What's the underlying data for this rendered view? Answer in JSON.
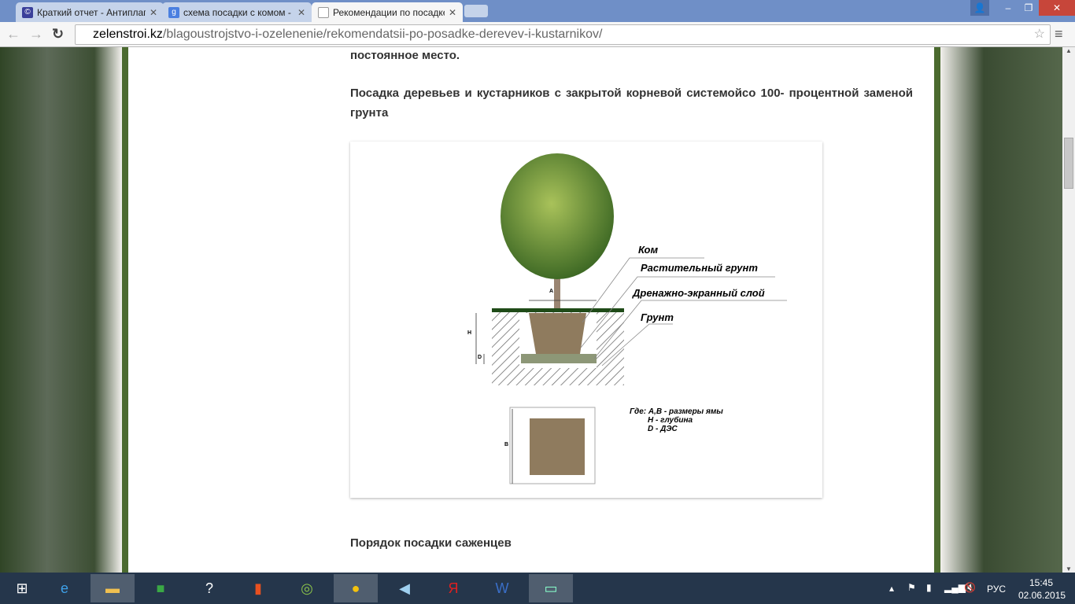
{
  "browser": {
    "tabs": [
      {
        "label": "Краткий отчет - Антиплаг",
        "icon": "antiplagiat-icon"
      },
      {
        "label": "схема посадки с комом -",
        "icon": "google-icon"
      },
      {
        "label": "Рекомендации по посадке",
        "icon": "page-icon"
      }
    ],
    "url_host": "zelenstroi.kz",
    "url_path": "/blagoustrojstvo-i-ozelenenie/rekomendatsii-po-posadke-derevev-i-kustarnikov/"
  },
  "article": {
    "top_fragment": "постоянное место.",
    "heading": "Посадка деревьев и кустарников с закрытой корневой системойсо 100- процентной заменой грунта",
    "next_heading": "Порядок посадки саженцев"
  },
  "figure": {
    "labels": {
      "kom": "Ком",
      "soil": "Растительный грунт",
      "drain": "Дренажно-экранный слой",
      "ground": "Грунт"
    },
    "dims": {
      "a": "A",
      "h": "H",
      "d": "D",
      "b": "B"
    },
    "legend": [
      "Где: А,В - размеры ямы",
      "Н - глубина",
      "D - ДЭС"
    ]
  },
  "taskbar": {
    "lang": "РУС",
    "time": "15:45",
    "date": "02.06.2015"
  }
}
